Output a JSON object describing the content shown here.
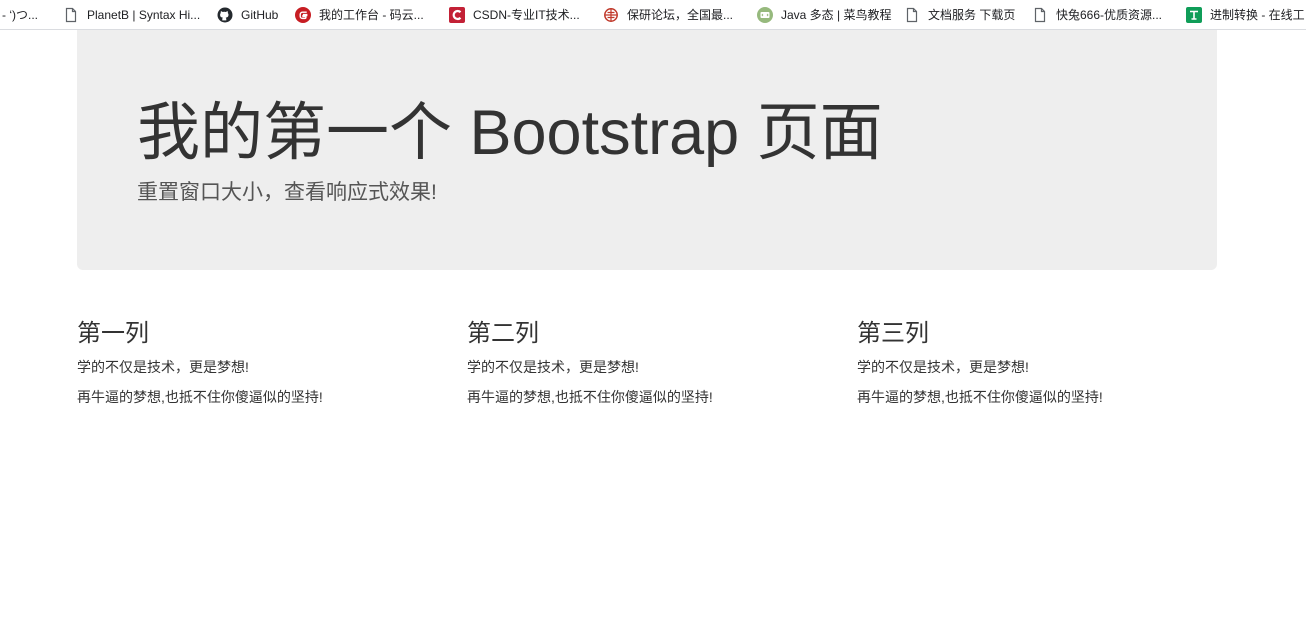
{
  "bookmarks": [
    {
      "label": "-  ‘)つ...",
      "icon": "none"
    },
    {
      "label": "PlanetB | Syntax Hi...",
      "icon": "page-icon"
    },
    {
      "label": "GitHub",
      "icon": "github-icon"
    },
    {
      "label": "我的工作台 - 码云...",
      "icon": "gitee-icon"
    },
    {
      "label": "CSDN-专业IT技术...",
      "icon": "csdn-icon"
    },
    {
      "label": "保研论坛，全国最...",
      "icon": "baoyan-icon"
    },
    {
      "label": "Java 多态 | 菜鸟教程",
      "icon": "runoob-icon"
    },
    {
      "label": "文档服务 下载页",
      "icon": "page-icon"
    },
    {
      "label": "快兔666-优质资源...",
      "icon": "page-icon"
    },
    {
      "label": "进制转换 - 在线工",
      "icon": "tool-icon"
    }
  ],
  "jumbotron": {
    "title": "我的第一个 Bootstrap 页面",
    "subtitle": "重置窗口大小，查看响应式效果!"
  },
  "columns": [
    {
      "heading": "第一列",
      "line1": "学的不仅是技术，更是梦想!",
      "line2": "再牛逼的梦想,也抵不住你傻逼似的坚持!"
    },
    {
      "heading": "第二列",
      "line1": "学的不仅是技术，更是梦想!",
      "line2": "再牛逼的梦想,也抵不住你傻逼似的坚持!"
    },
    {
      "heading": "第三列",
      "line1": "学的不仅是技术，更是梦想!",
      "line2": "再牛逼的梦想,也抵不住你傻逼似的坚持!"
    }
  ],
  "colors": {
    "jumbotron_bg": "#eeeeee",
    "text": "#333333",
    "gitee": "#c71d23",
    "csdn": "#c32136",
    "runoob": "#96b97d",
    "tool": "#0f9d58"
  }
}
